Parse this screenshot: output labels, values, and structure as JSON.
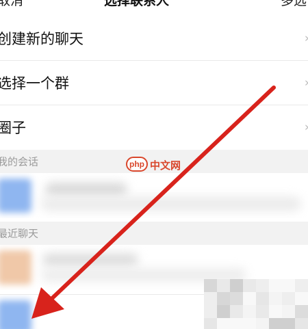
{
  "header": {
    "cancel_label": "取消",
    "title": "选择联系人",
    "multi_select_label": "多选"
  },
  "menu": [
    {
      "label": "创建新的聊天"
    },
    {
      "label": "选择一个群"
    },
    {
      "label": "圈子"
    }
  ],
  "sections": {
    "my_chats": "我的会话",
    "recent": "最近聊天"
  },
  "watermark": {
    "badge": "php",
    "text": "中文网"
  },
  "colors": {
    "arrow": "#d8231c",
    "section_bg": "#f2f2f2",
    "avatar_blue": "#8fb6f0",
    "avatar_peach": "#f0c8a8"
  }
}
